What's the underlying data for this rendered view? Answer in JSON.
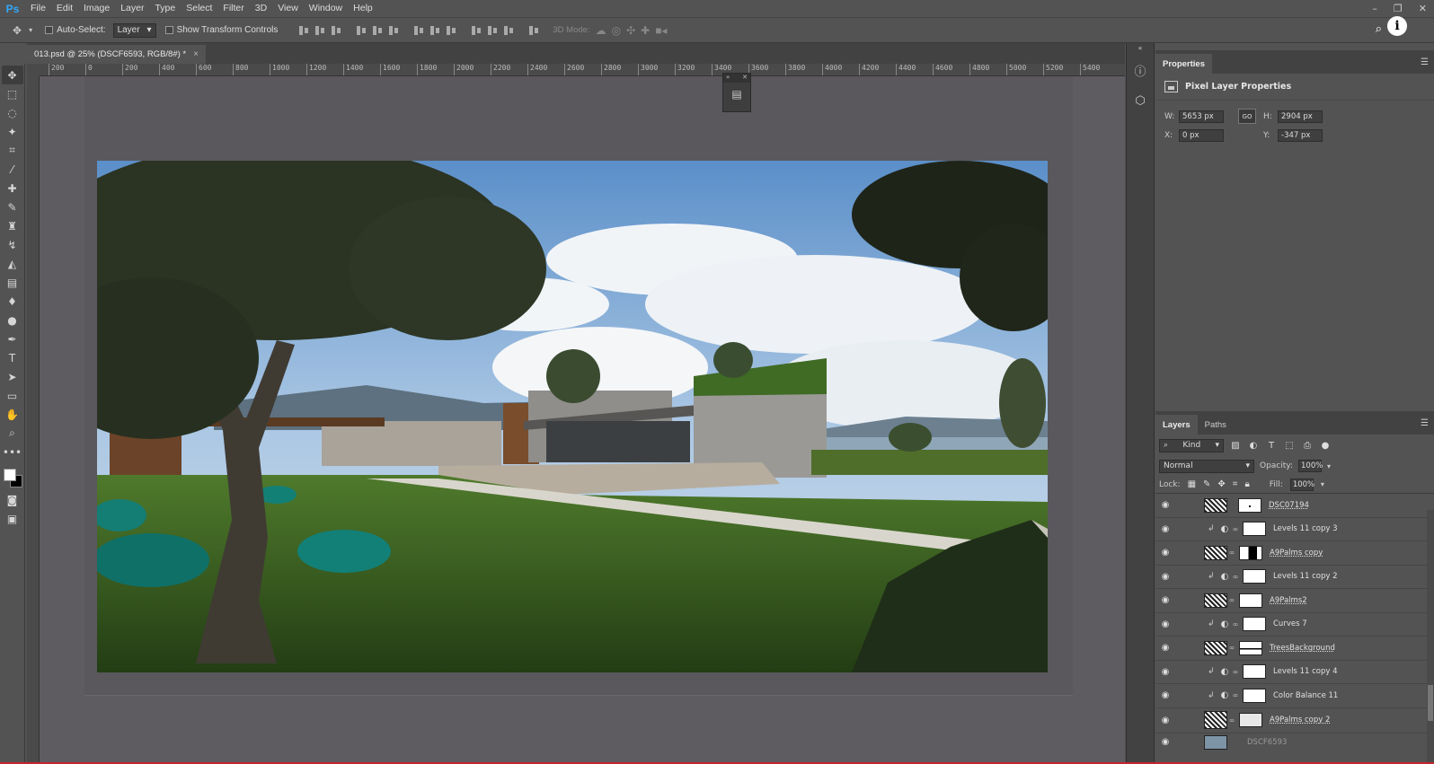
{
  "app": {
    "logo": "Ps",
    "menu": [
      "File",
      "Edit",
      "Image",
      "Layer",
      "Type",
      "Select",
      "Filter",
      "3D",
      "View",
      "Window",
      "Help"
    ],
    "window_controls": [
      "–",
      "❐",
      "✕"
    ]
  },
  "options": {
    "auto_select_label": "Auto-Select:",
    "auto_select_target": "Layer",
    "show_transform_label": "Show Transform Controls",
    "mode_3d_label": "3D Mode:"
  },
  "document": {
    "tab_title": "013.psd @ 25% (DSCF6593, RGB/8#) *",
    "close_glyph": "×"
  },
  "ruler": {
    "ticks": [
      "200",
      "0",
      "200",
      "400",
      "600",
      "800",
      "1000",
      "1200",
      "1400",
      "1600",
      "1800",
      "2000",
      "2200",
      "2400",
      "2600",
      "2800",
      "3000",
      "3200",
      "3400",
      "3600",
      "3800",
      "4000",
      "4200",
      "4400",
      "4600",
      "4800",
      "5000",
      "5200",
      "5400"
    ]
  },
  "properties": {
    "tab": "Properties",
    "title": "Pixel Layer Properties",
    "w_label": "W:",
    "w_value": "5653 px",
    "h_label": "H:",
    "h_value": "2904 px",
    "x_label": "X:",
    "x_value": "0 px",
    "y_label": "Y:",
    "y_value": "-347 px",
    "link_label": "GO"
  },
  "layers_panel": {
    "tabs": [
      "Layers",
      "Paths"
    ],
    "kind_label": "Kind",
    "blend_mode": "Normal",
    "opacity_label": "Opacity:",
    "opacity_value": "100%",
    "lock_label": "Lock:",
    "fill_label": "Fill:",
    "fill_value": "100%",
    "layers": [
      {
        "name": "DSC07194",
        "type": "pixel",
        "mask": "dot"
      },
      {
        "name": "Levels 11 copy 3",
        "type": "adjustment"
      },
      {
        "name": "A9Palms copy",
        "type": "pixel",
        "mask": "dark"
      },
      {
        "name": "Levels 11 copy 2",
        "type": "adjustment"
      },
      {
        "name": "A9Palms2",
        "type": "pixel",
        "mask": "plain"
      },
      {
        "name": "Curves 7",
        "type": "adjustment"
      },
      {
        "name": "TreesBackground",
        "type": "pixel",
        "mask": "half"
      },
      {
        "name": "Levels 11 copy 4",
        "type": "adjustment"
      },
      {
        "name": "Color Balance 11",
        "type": "adjustment"
      },
      {
        "name": "A9Palms copy 2",
        "type": "pixel",
        "mask": "grey"
      },
      {
        "name": "DSCF6593",
        "type": "pixel",
        "mask": "none"
      }
    ]
  },
  "colors": {
    "ui_bg": "#535353",
    "panel_dark": "#424242",
    "canvas_bg": "#5e5c60",
    "ps_blue": "#31a8ff"
  }
}
